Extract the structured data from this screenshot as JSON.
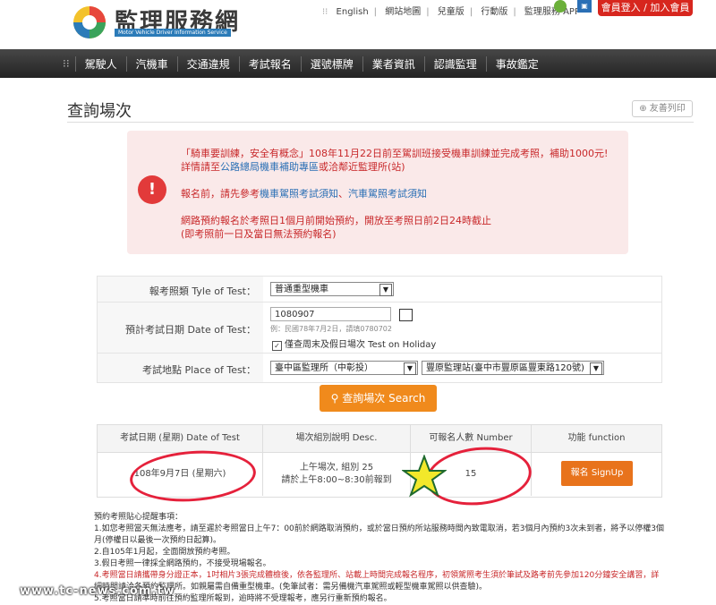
{
  "header": {
    "logo_title": "監理服務網",
    "logo_subtitle": "Motor Vehicle Driver Information Service",
    "top_links": [
      "English",
      "網站地圖",
      "兒童版",
      "行動版",
      "監理服務 APP"
    ],
    "login_button": "會員登入 / 加入會員"
  },
  "nav": {
    "items": [
      "駕駛人",
      "汽機車",
      "交通違規",
      "考試報名",
      "選號標牌",
      "業者資訊",
      "認識監理",
      "事故鑑定"
    ]
  },
  "page": {
    "title": "查詢場次",
    "print_button": "友善列印"
  },
  "notice": {
    "line1": "「騎車要訓練，安全有概念」108年11月22日前至駕訓班接受機車訓練並完成考照，補助1000元!",
    "line2_prefix": "詳情請至",
    "line2_link": "公路總局機車補助專區",
    "line2_suffix": "或洽鄰近監理所(站)",
    "line3_prefix": "報名前，請先參考",
    "line3_link1": "機車駕照考試須知",
    "line3_sep": "、",
    "line3_link2": "汽車駕照考試須知",
    "line4": "網路預約報名於考照日1個月前開始預約，開放至考照日前2日24時截止",
    "line5": "(即考照前一日及當日無法預約報名)"
  },
  "form": {
    "license_label": "報考照類 Tyle of Test：",
    "license_value": "普通重型機車",
    "date_label": "預計考試日期 Date of Test：",
    "date_value": "1080907",
    "date_hint": "例：民國78年7月2日，請填0780702",
    "holiday_label": "僅查周末及假日場次 Test on Holiday",
    "holiday_checked": "✓",
    "place_label": "考試地點 Place of Test：",
    "place_region": "臺中區監理所（中彰投）",
    "place_station": "豐原監理站(臺中市豐原區豐東路120號)"
  },
  "search_button": "查詢場次 Search",
  "results": {
    "headers": [
      "考試日期 (星期) Date of Test",
      "場次組別說明 Desc.",
      "可報名人數 Number",
      "功能 function"
    ],
    "rows": [
      {
        "date": "108年9月7日 (星期六)",
        "desc_line1": "上午場次, 組別 25",
        "desc_line2": "請於上午8:00~8:30前報到",
        "number": "15",
        "action": "報名 SignUp"
      }
    ]
  },
  "notes": {
    "title": "預約考照貼心提醒事項：",
    "items": [
      "1.如您考照當天無法應考，請至遲於考照當日上午7：00前於網路取消預約，或於當日預約所站服務時間內致電取消，若3個月內預約3次未到者，將予以停權3個",
      "月(停權日以最後一次預約日起算)。",
      "2.自105年1月起，全面開放預約考照。",
      "3.假日考照一律採全網路預約，不接受現場報名。",
      "4.考照當日請攜帶身分證正本，1吋相片3張完成體檢後，依各監理所、站載上時間完成報名程序，初領駕照考生須於筆試及路考前先參加120分鐘安全講習，詳",
      "細時間請洽各預約監理所。如親屬需自備重型機車。(免筆試者：需另備機汽車駕照或輕型機車駕照以供查驗)。",
      "5.考照當日請準時前往預約監理所報到，逾時將不受理報考，應另行重新預約報名。"
    ]
  },
  "watermark": "www.tc-news.com.tw"
}
